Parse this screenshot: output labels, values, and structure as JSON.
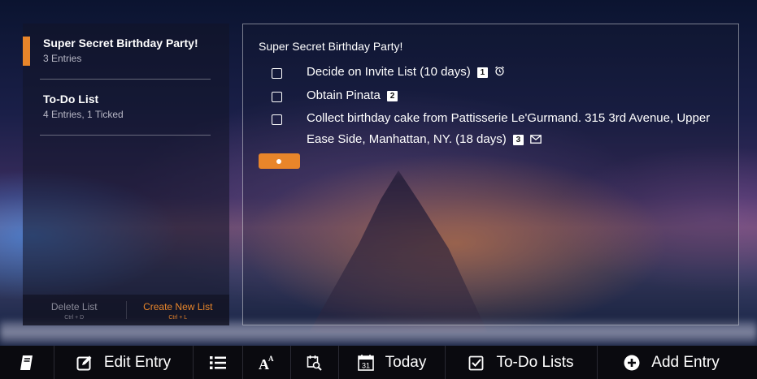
{
  "colors": {
    "accent": "#e8852a",
    "toolbar_bg": "#0a0a0f"
  },
  "sidebar": {
    "lists": [
      {
        "title": "Super Secret Birthday Party!",
        "subtitle": "3 Entries",
        "active": true
      },
      {
        "title": "To-Do List",
        "subtitle": "4 Entries, 1 Ticked",
        "active": false
      }
    ],
    "footer": {
      "delete_label": "Delete List",
      "delete_shortcut": "Ctrl + D",
      "create_label": "Create New List",
      "create_shortcut": "Ctrl + L"
    }
  },
  "main": {
    "title": "Super Secret Birthday Party!",
    "items": [
      {
        "text": "Decide on Invite List (10 days)",
        "badge": "1",
        "icon": "alarm-clock-icon",
        "checked": false
      },
      {
        "text": "Obtain Pinata",
        "badge": "2",
        "icon": "",
        "checked": false
      },
      {
        "text": "Collect birthday cake from Pattisserie Le'Gurmand. 315 3rd Avenue, Upper Ease Side, Manhattan, NY. (18 days)",
        "badge": "3",
        "icon": "envelope-icon",
        "checked": false
      }
    ]
  },
  "toolbar": {
    "journal_icon": "journal-icon",
    "edit_label": "Edit Entry",
    "list_icon": "list-icon",
    "font_icon": "font-size-icon",
    "search_icon": "calendar-search-icon",
    "today_calendar_day": "31",
    "today_label": "Today",
    "todo_label": "To-Do Lists",
    "add_label": "Add Entry"
  }
}
